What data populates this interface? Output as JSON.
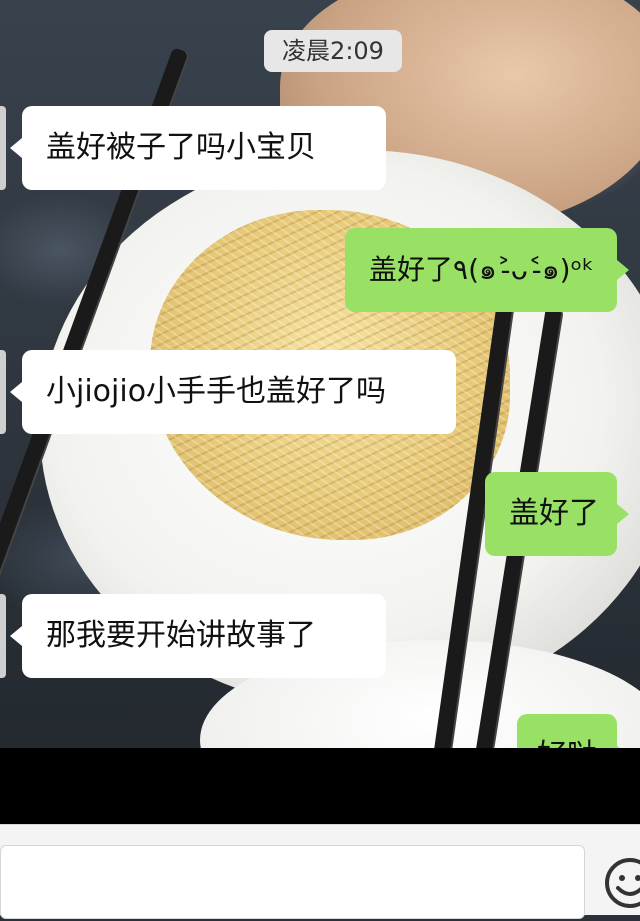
{
  "chat": {
    "timestamp": "凌晨2:09",
    "messages": [
      {
        "side": "left",
        "text": "盖好被子了吗小宝贝"
      },
      {
        "side": "right",
        "text": "盖好了٩(๑˃̵ᴗ˂̵๑)ᵒᵏ"
      },
      {
        "side": "left",
        "text": "小jiojio小手手也盖好了吗"
      },
      {
        "side": "right",
        "text": "盖好了"
      },
      {
        "side": "left",
        "text": "那我要开始讲故事了"
      },
      {
        "side": "right",
        "text": "好哒"
      }
    ]
  },
  "input_bar": {
    "emoji_icon": "emoji-smile-icon"
  },
  "colors": {
    "incoming_bubble": "#ffffff",
    "outgoing_bubble": "#98e165",
    "timestamp_bg": "#e7e7e7"
  }
}
